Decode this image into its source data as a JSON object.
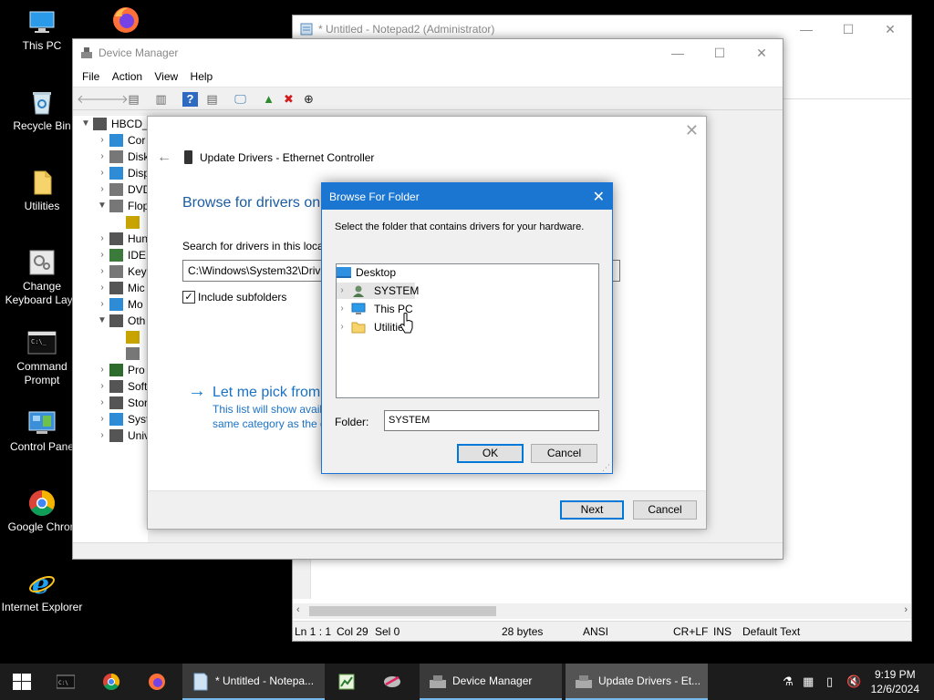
{
  "desktop": {
    "icons": [
      {
        "label": "This PC"
      },
      {
        "label": ""
      },
      {
        "label": "Recycle Bin"
      },
      {
        "label": "Utilities"
      },
      {
        "label": "Change Keyboard Layo"
      },
      {
        "label": "Command Prompt"
      },
      {
        "label": "Control Pane"
      },
      {
        "label": "Google Chron"
      },
      {
        "label": "Internet Explorer"
      }
    ]
  },
  "notepad": {
    "title": "* Untitled - Notepad2 (Administrator)",
    "status": {
      "position": "Ln 1 : 1",
      "col": "Col 29",
      "sel": "Sel 0",
      "size": "28 bytes",
      "encoding": "ANSI",
      "eol": "CR+LF",
      "ins": "INS",
      "scheme": "Default Text"
    }
  },
  "device_manager": {
    "title": "Device Manager",
    "menu": [
      "File",
      "Action",
      "View",
      "Help"
    ],
    "tree": [
      {
        "label": "HBCD_",
        "expander": "▼",
        "indent": 0
      },
      {
        "label": "Cor",
        "expander": "›",
        "indent": 1
      },
      {
        "label": "Disk",
        "expander": "›",
        "indent": 1
      },
      {
        "label": "Disp",
        "expander": "›",
        "indent": 1
      },
      {
        "label": "DVD",
        "expander": "›",
        "indent": 1
      },
      {
        "label": "Flop",
        "expander": "▼",
        "indent": 1
      },
      {
        "label": "",
        "expander": "",
        "indent": 2
      },
      {
        "label": "Hun",
        "expander": "›",
        "indent": 1
      },
      {
        "label": "IDE",
        "expander": "›",
        "indent": 1
      },
      {
        "label": "Key",
        "expander": "›",
        "indent": 1
      },
      {
        "label": "Mic",
        "expander": "›",
        "indent": 1
      },
      {
        "label": "Mo",
        "expander": "›",
        "indent": 1
      },
      {
        "label": "Oth",
        "expander": "▼",
        "indent": 1
      },
      {
        "label": "",
        "expander": "",
        "indent": 2
      },
      {
        "label": "",
        "expander": "",
        "indent": 2
      },
      {
        "label": "Pro",
        "expander": "›",
        "indent": 1
      },
      {
        "label": "Soft",
        "expander": "›",
        "indent": 1
      },
      {
        "label": "Stor",
        "expander": "›",
        "indent": 1
      },
      {
        "label": "Syst",
        "expander": "›",
        "indent": 1
      },
      {
        "label": "Univ",
        "expander": "›",
        "indent": 1
      }
    ]
  },
  "wizard": {
    "title": "Update Drivers - Ethernet Controller",
    "heading": "Browse for drivers on",
    "search_label": "Search for drivers in this loca",
    "path": "C:\\Windows\\System32\\Driv",
    "include_label": "Include subfolders",
    "include_checked": "✓",
    "pick_label": "Let me pick from",
    "pick_desc1": "This list will show avail",
    "pick_desc2": "same category as the d",
    "next_label": "Next",
    "cancel_label": "Cancel"
  },
  "browse": {
    "title": "Browse For Folder",
    "prompt": "Select the folder that contains drivers for your hardware.",
    "tree": [
      {
        "label": "Desktop",
        "expander": ""
      },
      {
        "label": "SYSTEM",
        "expander": "›"
      },
      {
        "label": "This PC",
        "expander": "›"
      },
      {
        "label": "Utilitie",
        "expander": "›"
      }
    ],
    "folder_label": "Folder:",
    "folder_value": "SYSTEM",
    "ok_label": "OK",
    "cancel_label": "Cancel"
  },
  "taskbar": {
    "items": [
      {
        "label": "* Untitled - Notepa..."
      },
      {
        "label": "Device Manager"
      },
      {
        "label": "Update Drivers - Et..."
      }
    ],
    "time": "9:19 PM",
    "date": "12/6/2024"
  }
}
